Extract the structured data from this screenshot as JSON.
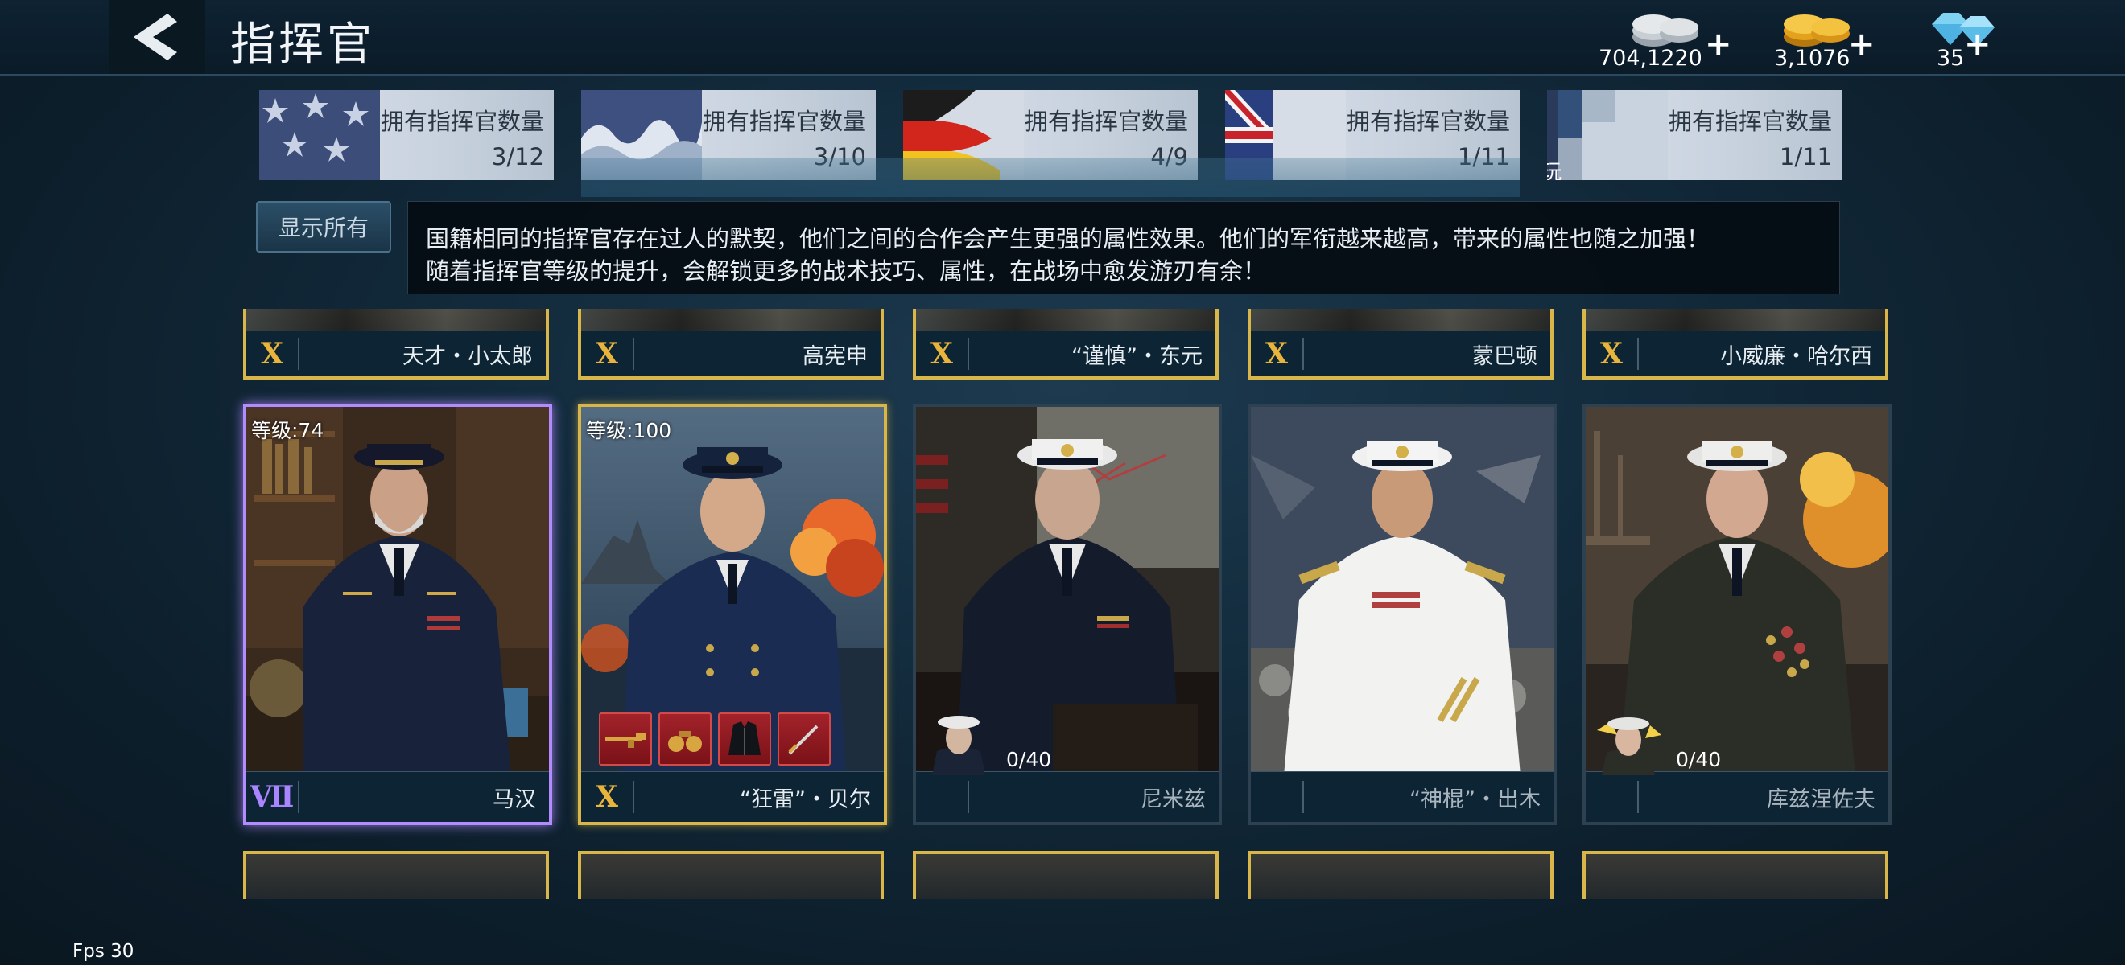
{
  "header": {
    "title": "指挥官",
    "currencies": [
      {
        "name": "silver",
        "value": "704,1220",
        "plus": "+"
      },
      {
        "name": "gold",
        "value": "3,1076",
        "plus": "+"
      },
      {
        "name": "diamond",
        "value": "35",
        "plus": "+"
      }
    ]
  },
  "nations": [
    {
      "label": "拥有指挥官数量",
      "count": "3/12"
    },
    {
      "label": "拥有指挥官数量",
      "count": "3/10"
    },
    {
      "label": "拥有指挥官数量",
      "count": "4/9"
    },
    {
      "label": "拥有指挥官数量",
      "count": "1/11"
    },
    {
      "label": "拥有指挥官数量",
      "count": "1/11",
      "tag": "玩"
    }
  ],
  "filter": {
    "show_all": "显示所有"
  },
  "info": {
    "line1": "国籍相同的指挥官存在过人的默契，他们之间的合作会产生更强的属性效果。他们的军衔越来越高，带来的属性也随之加强！",
    "line2": "随着指挥官等级的提升，会解锁更多的战术技巧、属性，在战场中愈发游刃有余！"
  },
  "top_row": [
    {
      "rank": "X",
      "name": "天才・小太郎"
    },
    {
      "rank": "X",
      "name": "高宪申"
    },
    {
      "rank": "X",
      "name": "“谨慎”・东元"
    },
    {
      "rank": "X",
      "name": "蒙巴顿"
    },
    {
      "rank": "X",
      "name": "小威廉・哈尔西"
    }
  ],
  "commanders": [
    {
      "level": "等级:74",
      "rank": "Ⅶ",
      "name": "马汉"
    },
    {
      "level": "等级:100",
      "rank": "X",
      "name": "“狂雷”・贝尔"
    },
    {
      "progress": "0/40",
      "name": "尼米兹"
    },
    {
      "name": "“神棍”・出木"
    },
    {
      "progress": "0/40",
      "name": "库兹涅佐夫"
    }
  ],
  "fps": "Fps 30",
  "colors": {
    "gold_border": "#d9b649",
    "purple_border": "#b28bff",
    "rank_gold": "#e8b43c",
    "rank_purple": "#a985ff"
  }
}
